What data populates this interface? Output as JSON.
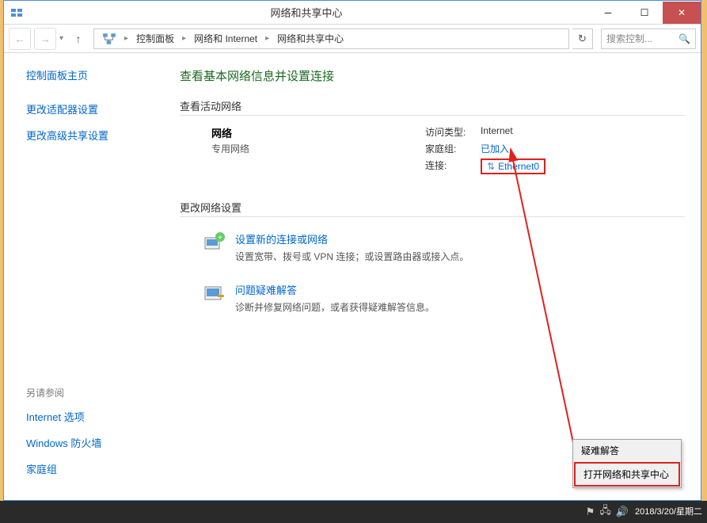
{
  "titlebar": {
    "title": "网络和共享中心"
  },
  "breadcrumb": {
    "items": [
      "控制面板",
      "网络和 Internet",
      "网络和共享中心"
    ],
    "search_placeholder": "搜索控制..."
  },
  "sidebar": {
    "home": "控制面板主页",
    "links": [
      "更改适配器设置",
      "更改高级共享设置"
    ],
    "seealso_title": "另请参阅",
    "seealso": [
      "Internet 选项",
      "Windows 防火墙",
      "家庭组"
    ]
  },
  "content": {
    "heading": "查看基本网络信息并设置连接",
    "active_section": "查看活动网络",
    "network": {
      "name": "网络",
      "type": "专用网络"
    },
    "details": {
      "access_label": "访问类型:",
      "access_value": "Internet",
      "homegroup_label": "家庭组:",
      "homegroup_value": "已加入",
      "conn_label": "连接:",
      "conn_value": "Ethernet0"
    },
    "change_section": "更改网络设置",
    "task1": {
      "title": "设置新的连接或网络",
      "desc": "设置宽带、拨号或 VPN 连接；或设置路由器或接入点。"
    },
    "task2": {
      "title": "问题疑难解答",
      "desc": "诊断并修复网络问题，或者获得疑难解答信息。"
    }
  },
  "context_menu": {
    "item1": "疑难解答",
    "item2": "打开网络和共享中心"
  },
  "taskbar": {
    "date": "2018/3/20/星期二"
  }
}
